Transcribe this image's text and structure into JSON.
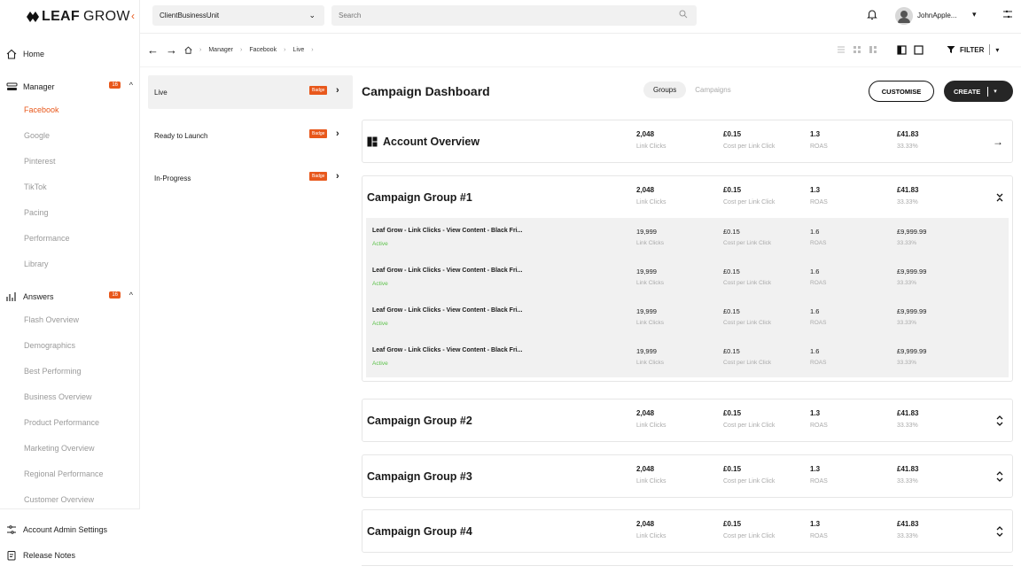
{
  "brand": {
    "logo_bold": "LEAF",
    "logo_light": "GROW",
    "accent": "#e8581c"
  },
  "sidebar": {
    "home": "Home",
    "manager": {
      "label": "Manager",
      "badge": "16",
      "items": [
        "Facebook",
        "Google",
        "Pinterest",
        "TikTok",
        "Pacing",
        "Performance",
        "Library"
      ]
    },
    "answers": {
      "label": "Answers",
      "badge": "16",
      "items": [
        "Flash Overview",
        "Demographics",
        "Best Performing",
        "Business Overview",
        "Product Performance",
        "Marketing Overview",
        "Regional Performance",
        "Customer Overview"
      ]
    },
    "footer": [
      "Account Admin Settings",
      "Release Notes"
    ]
  },
  "topbar": {
    "business_unit": "ClientBusinessUnit",
    "search_placeholder": "Search",
    "username": "JohnApple..."
  },
  "breadcrumb": [
    "Manager",
    "Facebook",
    "Live"
  ],
  "filter_label": "FILTER",
  "status_panel": [
    {
      "label": "Live",
      "badge": "Badge"
    },
    {
      "label": "Ready to Launch",
      "badge": "Badge"
    },
    {
      "label": "In-Progress",
      "badge": "Badge"
    }
  ],
  "dashboard": {
    "title": "Campaign Dashboard",
    "tab_groups": "Groups",
    "tab_campaigns": "Campaigns",
    "customise": "CUSTOMISE",
    "create": "CREATE"
  },
  "account_overview": {
    "title": "Account Overview",
    "metrics": [
      {
        "value": "2,048",
        "label": "Link Clicks"
      },
      {
        "value": "£0.15",
        "label": "Cost per Link Click"
      },
      {
        "value": "1.3",
        "label": "ROAS"
      },
      {
        "value": "£41.83",
        "label": "33.33%"
      }
    ]
  },
  "groups": [
    {
      "title": "Campaign Group #1",
      "metrics": [
        {
          "value": "2,048",
          "label": "Link Clicks"
        },
        {
          "value": "£0.15",
          "label": "Cost per Link Click"
        },
        {
          "value": "1.3",
          "label": "ROAS"
        },
        {
          "value": "£41.83",
          "label": "33.33%"
        }
      ],
      "campaigns": [
        {
          "name": "Leaf Grow - Link Clicks - View Content - Black Fri...",
          "status": "Active",
          "metrics": [
            {
              "value": "19,999",
              "label": "Link Clicks"
            },
            {
              "value": "£0.15",
              "label": "Cost per Link Click"
            },
            {
              "value": "1.6",
              "label": "ROAS"
            },
            {
              "value": "£9,999.99",
              "label": "33.33%"
            }
          ]
        },
        {
          "name": "Leaf Grow - Link Clicks - View Content - Black Fri...",
          "status": "Active",
          "metrics": [
            {
              "value": "19,999",
              "label": "Link Clicks"
            },
            {
              "value": "£0.15",
              "label": "Cost per Link Click"
            },
            {
              "value": "1.6",
              "label": "ROAS"
            },
            {
              "value": "£9,999.99",
              "label": "33.33%"
            }
          ]
        },
        {
          "name": "Leaf Grow - Link Clicks - View Content - Black Fri...",
          "status": "Active",
          "metrics": [
            {
              "value": "19,999",
              "label": "Link Clicks"
            },
            {
              "value": "£0.15",
              "label": "Cost per Link Click"
            },
            {
              "value": "1.6",
              "label": "ROAS"
            },
            {
              "value": "£9,999.99",
              "label": "33.33%"
            }
          ]
        },
        {
          "name": "Leaf Grow - Link Clicks - View Content - Black Fri...",
          "status": "Active",
          "metrics": [
            {
              "value": "19,999",
              "label": "Link Clicks"
            },
            {
              "value": "£0.15",
              "label": "Cost per Link Click"
            },
            {
              "value": "1.6",
              "label": "ROAS"
            },
            {
              "value": "£9,999.99",
              "label": "33.33%"
            }
          ]
        }
      ]
    },
    {
      "title": "Campaign Group #2",
      "metrics": [
        {
          "value": "2,048",
          "label": "Link Clicks"
        },
        {
          "value": "£0.15",
          "label": "Cost per Link Click"
        },
        {
          "value": "1.3",
          "label": "ROAS"
        },
        {
          "value": "£41.83",
          "label": "33.33%"
        }
      ]
    },
    {
      "title": "Campaign Group #3",
      "metrics": [
        {
          "value": "2,048",
          "label": "Link Clicks"
        },
        {
          "value": "£0.15",
          "label": "Cost per Link Click"
        },
        {
          "value": "1.3",
          "label": "ROAS"
        },
        {
          "value": "£41.83",
          "label": "33.33%"
        }
      ]
    },
    {
      "title": "Campaign Group #4",
      "metrics": [
        {
          "value": "2,048",
          "label": "Link Clicks"
        },
        {
          "value": "£0.15",
          "label": "Cost per Link Click"
        },
        {
          "value": "1.3",
          "label": "ROAS"
        },
        {
          "value": "£41.83",
          "label": "33.33%"
        }
      ]
    }
  ]
}
